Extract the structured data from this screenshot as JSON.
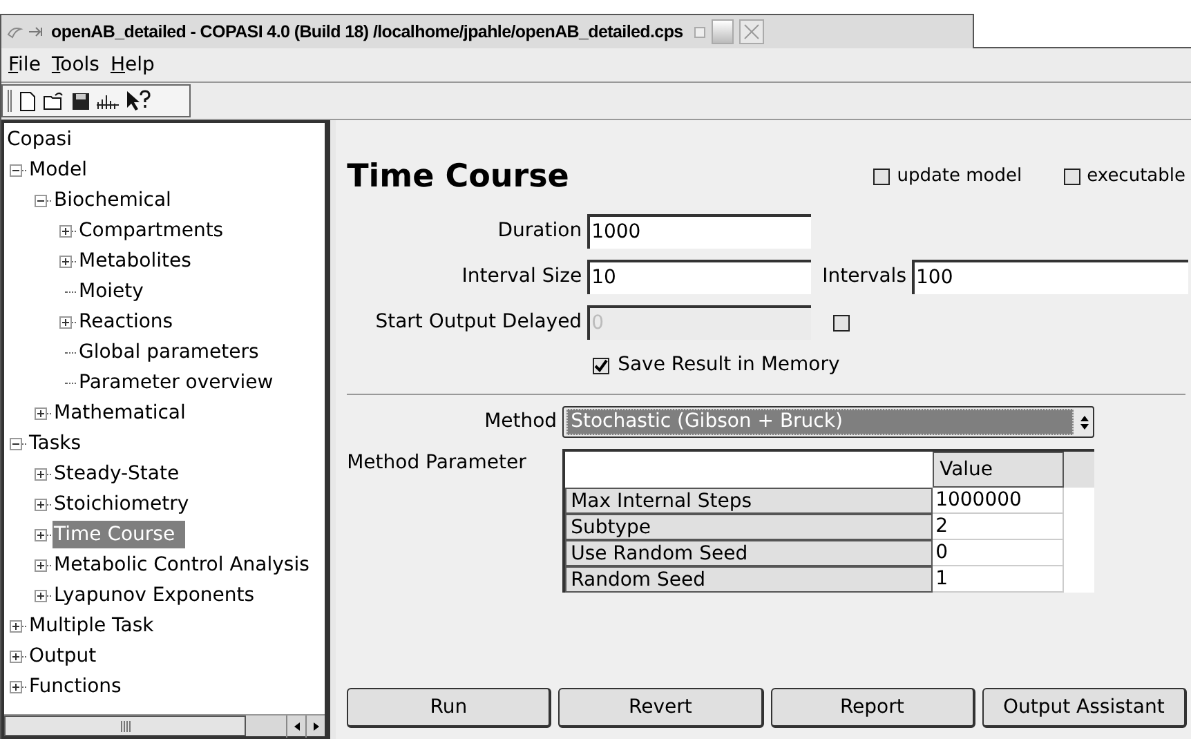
{
  "window": {
    "title": "openAB_detailed - COPASI 4.0 (Build 18) /localhome/jpahle/openAB_detailed.cps"
  },
  "menu": [
    {
      "label": "File"
    },
    {
      "label": "Tools"
    },
    {
      "label": "Help"
    }
  ],
  "tree": {
    "root": "Copasi",
    "items": [
      {
        "label": "Model",
        "kind": "branch",
        "expanded": true,
        "selected": false,
        "children": [
          {
            "label": "Biochemical",
            "kind": "branch",
            "expanded": true,
            "selected": false,
            "children": [
              {
                "label": "Compartments",
                "kind": "branch",
                "expanded": false,
                "selected": false
              },
              {
                "label": "Metabolites",
                "kind": "branch",
                "expanded": false,
                "selected": false
              },
              {
                "label": "Moiety",
                "kind": "leaf",
                "selected": false
              },
              {
                "label": "Reactions",
                "kind": "branch",
                "expanded": false,
                "selected": false
              },
              {
                "label": "Global parameters",
                "kind": "leaf",
                "selected": false
              },
              {
                "label": "Parameter overview",
                "kind": "leaf",
                "selected": false
              }
            ]
          },
          {
            "label": "Mathematical",
            "kind": "branch",
            "expanded": false,
            "selected": false
          }
        ]
      },
      {
        "label": "Tasks",
        "kind": "branch",
        "expanded": true,
        "selected": false,
        "children": [
          {
            "label": "Steady-State",
            "kind": "branch",
            "expanded": false,
            "selected": false
          },
          {
            "label": "Stoichiometry",
            "kind": "branch",
            "expanded": false,
            "selected": false
          },
          {
            "label": "Time Course",
            "kind": "branch",
            "expanded": false,
            "selected": true
          },
          {
            "label": "Metabolic Control Analysis",
            "kind": "branch",
            "expanded": false,
            "selected": false
          },
          {
            "label": "Lyapunov Exponents",
            "kind": "branch",
            "expanded": false,
            "selected": false
          }
        ]
      },
      {
        "label": "Multiple Task",
        "kind": "branch",
        "expanded": false,
        "selected": false
      },
      {
        "label": "Output",
        "kind": "branch",
        "expanded": false,
        "selected": false
      },
      {
        "label": "Functions",
        "kind": "branch",
        "expanded": false,
        "selected": false
      }
    ]
  },
  "task": {
    "title": "Time Course",
    "update_model": {
      "label": "update model",
      "checked": false
    },
    "executable": {
      "label": "executable",
      "checked": false
    },
    "duration": {
      "label": "Duration",
      "value": "1000"
    },
    "interval_size": {
      "label": "Interval Size",
      "value": "10"
    },
    "intervals": {
      "label": "Intervals",
      "value": "100"
    },
    "start_output_delayed": {
      "label": "Start Output Delayed",
      "value": "0",
      "disabled": true,
      "checked": false
    },
    "save_result": {
      "label": "Save Result in Memory",
      "checked": true
    },
    "method": {
      "label": "Method",
      "value": "Stochastic (Gibson + Bruck)"
    },
    "method_parameter": {
      "label": "Method Parameter",
      "column": "Value",
      "rows": [
        {
          "name": "Max Internal Steps",
          "value": "1000000"
        },
        {
          "name": "Subtype",
          "value": "2"
        },
        {
          "name": "Use Random Seed",
          "value": "0"
        },
        {
          "name": "Random Seed",
          "value": "1"
        }
      ]
    }
  },
  "buttons": [
    "Run",
    "Revert",
    "Report",
    "Output Assistant"
  ]
}
